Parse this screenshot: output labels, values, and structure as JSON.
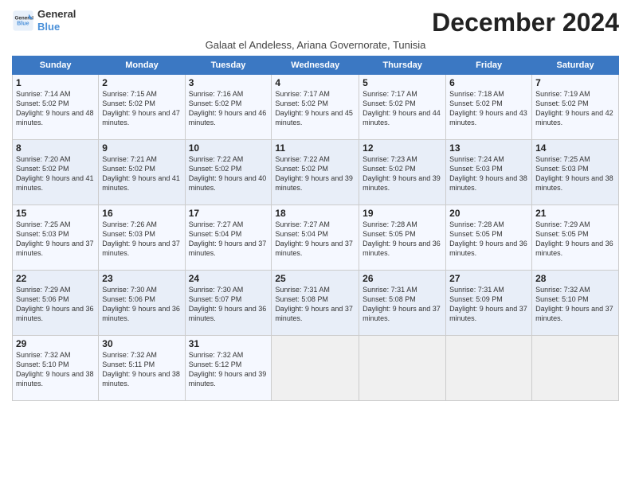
{
  "header": {
    "logo_line1": "General",
    "logo_line2": "Blue",
    "month_title": "December 2024",
    "subtitle": "Galaat el Andeless, Ariana Governorate, Tunisia"
  },
  "days_of_week": [
    "Sunday",
    "Monday",
    "Tuesday",
    "Wednesday",
    "Thursday",
    "Friday",
    "Saturday"
  ],
  "weeks": [
    [
      {
        "num": "1",
        "rise": "7:14 AM",
        "set": "5:02 PM",
        "daylight": "9 hours and 48 minutes."
      },
      {
        "num": "2",
        "rise": "7:15 AM",
        "set": "5:02 PM",
        "daylight": "9 hours and 47 minutes."
      },
      {
        "num": "3",
        "rise": "7:16 AM",
        "set": "5:02 PM",
        "daylight": "9 hours and 46 minutes."
      },
      {
        "num": "4",
        "rise": "7:17 AM",
        "set": "5:02 PM",
        "daylight": "9 hours and 45 minutes."
      },
      {
        "num": "5",
        "rise": "7:17 AM",
        "set": "5:02 PM",
        "daylight": "9 hours and 44 minutes."
      },
      {
        "num": "6",
        "rise": "7:18 AM",
        "set": "5:02 PM",
        "daylight": "9 hours and 43 minutes."
      },
      {
        "num": "7",
        "rise": "7:19 AM",
        "set": "5:02 PM",
        "daylight": "9 hours and 42 minutes."
      }
    ],
    [
      {
        "num": "8",
        "rise": "7:20 AM",
        "set": "5:02 PM",
        "daylight": "9 hours and 41 minutes."
      },
      {
        "num": "9",
        "rise": "7:21 AM",
        "set": "5:02 PM",
        "daylight": "9 hours and 41 minutes."
      },
      {
        "num": "10",
        "rise": "7:22 AM",
        "set": "5:02 PM",
        "daylight": "9 hours and 40 minutes."
      },
      {
        "num": "11",
        "rise": "7:22 AM",
        "set": "5:02 PM",
        "daylight": "9 hours and 39 minutes."
      },
      {
        "num": "12",
        "rise": "7:23 AM",
        "set": "5:02 PM",
        "daylight": "9 hours and 39 minutes."
      },
      {
        "num": "13",
        "rise": "7:24 AM",
        "set": "5:03 PM",
        "daylight": "9 hours and 38 minutes."
      },
      {
        "num": "14",
        "rise": "7:25 AM",
        "set": "5:03 PM",
        "daylight": "9 hours and 38 minutes."
      }
    ],
    [
      {
        "num": "15",
        "rise": "7:25 AM",
        "set": "5:03 PM",
        "daylight": "9 hours and 37 minutes."
      },
      {
        "num": "16",
        "rise": "7:26 AM",
        "set": "5:03 PM",
        "daylight": "9 hours and 37 minutes."
      },
      {
        "num": "17",
        "rise": "7:27 AM",
        "set": "5:04 PM",
        "daylight": "9 hours and 37 minutes."
      },
      {
        "num": "18",
        "rise": "7:27 AM",
        "set": "5:04 PM",
        "daylight": "9 hours and 37 minutes."
      },
      {
        "num": "19",
        "rise": "7:28 AM",
        "set": "5:05 PM",
        "daylight": "9 hours and 36 minutes."
      },
      {
        "num": "20",
        "rise": "7:28 AM",
        "set": "5:05 PM",
        "daylight": "9 hours and 36 minutes."
      },
      {
        "num": "21",
        "rise": "7:29 AM",
        "set": "5:05 PM",
        "daylight": "9 hours and 36 minutes."
      }
    ],
    [
      {
        "num": "22",
        "rise": "7:29 AM",
        "set": "5:06 PM",
        "daylight": "9 hours and 36 minutes."
      },
      {
        "num": "23",
        "rise": "7:30 AM",
        "set": "5:06 PM",
        "daylight": "9 hours and 36 minutes."
      },
      {
        "num": "24",
        "rise": "7:30 AM",
        "set": "5:07 PM",
        "daylight": "9 hours and 36 minutes."
      },
      {
        "num": "25",
        "rise": "7:31 AM",
        "set": "5:08 PM",
        "daylight": "9 hours and 37 minutes."
      },
      {
        "num": "26",
        "rise": "7:31 AM",
        "set": "5:08 PM",
        "daylight": "9 hours and 37 minutes."
      },
      {
        "num": "27",
        "rise": "7:31 AM",
        "set": "5:09 PM",
        "daylight": "9 hours and 37 minutes."
      },
      {
        "num": "28",
        "rise": "7:32 AM",
        "set": "5:10 PM",
        "daylight": "9 hours and 37 minutes."
      }
    ],
    [
      {
        "num": "29",
        "rise": "7:32 AM",
        "set": "5:10 PM",
        "daylight": "9 hours and 38 minutes."
      },
      {
        "num": "30",
        "rise": "7:32 AM",
        "set": "5:11 PM",
        "daylight": "9 hours and 38 minutes."
      },
      {
        "num": "31",
        "rise": "7:32 AM",
        "set": "5:12 PM",
        "daylight": "9 hours and 39 minutes."
      },
      null,
      null,
      null,
      null
    ]
  ]
}
